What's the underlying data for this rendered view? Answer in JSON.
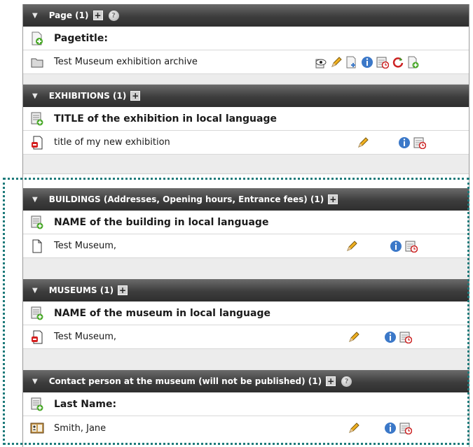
{
  "sections": [
    {
      "header": "Page (1)",
      "field_label": "Pagetitle:",
      "item": "Test Museum exhibition archive"
    },
    {
      "header": "EXHIBITIONS (1)",
      "field_label": "TITLE of the exhibition in local language",
      "item": "title of my new exhibition"
    },
    {
      "header": "BUILDINGS (Addresses, Opening hours, Entrance fees) (1)",
      "field_label": "NAME of the building in local language",
      "item": "Test Museum,"
    },
    {
      "header": "MUSEUMS (1)",
      "field_label": "NAME of the museum in local language",
      "item": "Test Museum,"
    },
    {
      "header": "Contact person at the museum (will not be published) (1)",
      "field_label": "Last Name:",
      "item": "Smith, Jane"
    }
  ],
  "icons": {
    "add": "add-icon",
    "help": "help-icon",
    "preview": "preview-icon",
    "edit": "pencil-icon",
    "move": "move-icon",
    "info": "info-icon",
    "schedule": "calendar-icon",
    "refresh": "refresh-icon",
    "new_page": "new-page-icon"
  },
  "colors": {
    "header_bg": "#3d3d3d",
    "highlight_border": "#1d7a7a",
    "info_blue": "#3b78c8",
    "add_green": "#4caa2c"
  }
}
